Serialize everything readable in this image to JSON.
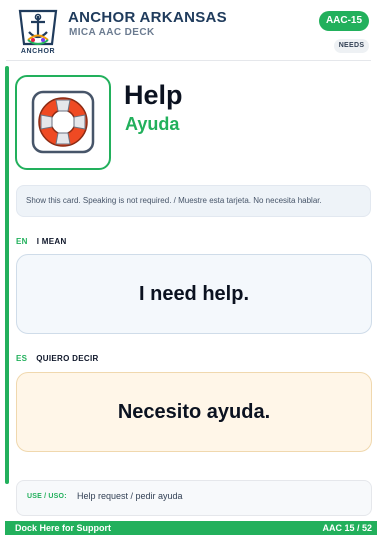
{
  "header": {
    "brand_title": "ANCHOR ARKANSAS",
    "brand_subtitle": "MICA AAC DECK",
    "logo_text": "ANCHOR",
    "code_badge": "AAC-15",
    "category_badge": "NEEDS"
  },
  "card": {
    "icon": "lifebuoy-icon",
    "word_en": "Help",
    "word_es": "Ayuda",
    "instruction": "Show this card. Speaking is not required. / Muestre esta tarjeta. No necesita hablar.",
    "section_en": {
      "lang": "EN",
      "label": "I MEAN",
      "phrase": "I need help."
    },
    "section_es": {
      "lang": "ES",
      "label": "QUIERO DECIR",
      "phrase": "Necesito ayuda."
    },
    "use": {
      "label": "USE / USO:",
      "text": "Help request / pedir ayuda"
    }
  },
  "footer": {
    "left": "Dock Here for Support",
    "right": "AAC 15 / 52"
  },
  "colors": {
    "accent": "#22b05c",
    "brand": "#1f3b5c",
    "phrase_en_bg": "#f4f8fc",
    "phrase_es_bg": "#fff6e8"
  }
}
